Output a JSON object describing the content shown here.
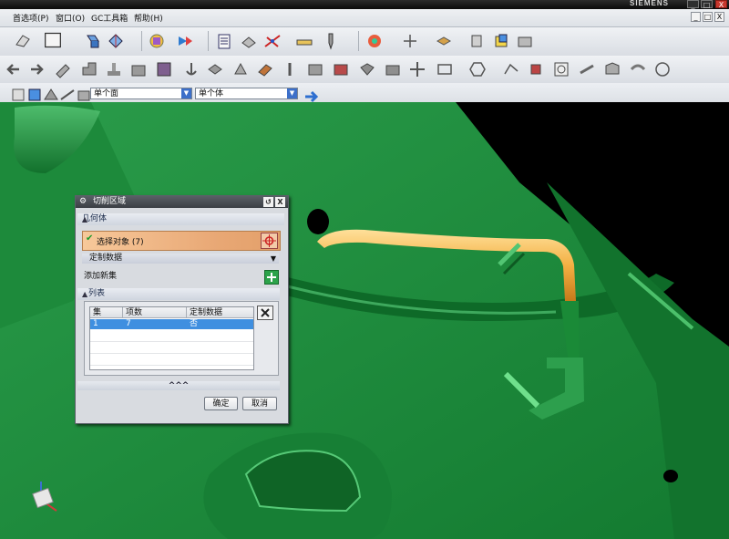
{
  "window": {
    "brand": "SIEMENS",
    "min_glyph": "_",
    "restore_glyph": "□",
    "close_glyph": "X"
  },
  "menu": {
    "items": [
      "首选项(P)",
      "窗口(O)",
      "GC工具箱",
      "帮助(H)"
    ],
    "doc_min_glyph": "_",
    "doc_restore_glyph": "□",
    "doc_close_glyph": "X"
  },
  "selection_bar": {
    "face_filter": "单个面",
    "body_filter": "单个体"
  },
  "dialog": {
    "title": "切削区域",
    "reset_glyph": "↺",
    "close_glyph": "X",
    "geometry_group": "几何体",
    "select_object": "选择对象 (7)",
    "custom_data": "定制数据",
    "add_new_set": "添加新集",
    "list_group": "列表",
    "table": {
      "headers": [
        "集",
        "项数",
        "定制数据"
      ],
      "rows": [
        {
          "set": "1",
          "count": "7",
          "custom": "否"
        }
      ]
    },
    "more_glyph": "^^^",
    "ok": "确定",
    "cancel": "取消"
  },
  "colors": {
    "model_green": "#1f8a3a",
    "highlight_orange": "#f3b043",
    "selected_row": "#3f8fe0",
    "dialog_title": "#454a51"
  }
}
